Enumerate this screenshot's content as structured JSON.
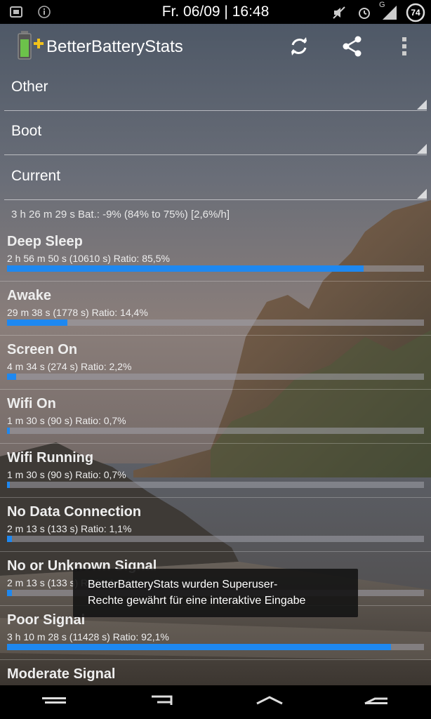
{
  "status_bar": {
    "time": "Fr. 06/09 | 16:48",
    "battery_level": "74",
    "left_icons": [
      "android-debug-icon",
      "info-icon"
    ],
    "right_icons": [
      "mute-icon",
      "alarm-icon",
      "signal-icon",
      "battery-icon"
    ],
    "signal_label": "G"
  },
  "app_bar": {
    "title": "BetterBatteryStats",
    "actions": [
      "refresh-icon",
      "share-icon",
      "overflow-menu-icon"
    ]
  },
  "spinners": [
    {
      "value": "Other"
    },
    {
      "value": "Boot"
    },
    {
      "value": "Current"
    }
  ],
  "summary": "3 h 26 m 29 s  Bat.: -9% (84% to 75%) [2,6%/h]",
  "stats": [
    {
      "name": "Deep Sleep",
      "detail": "2 h 56 m 50 s  (10610 s) Ratio: 85,5%",
      "ratio": 0.855
    },
    {
      "name": "Awake",
      "detail": "29 m 38 s  (1778 s) Ratio: 14,4%",
      "ratio": 0.144
    },
    {
      "name": "Screen On",
      "detail": "4 m 34 s  (274 s) Ratio: 2,2%",
      "ratio": 0.022
    },
    {
      "name": "Wifi On",
      "detail": "1 m 30 s  (90 s) Ratio: 0,7%",
      "ratio": 0.007
    },
    {
      "name": "Wifi Running",
      "detail": "1 m 30 s  (90 s) Ratio: 0,7%",
      "ratio": 0.007
    },
    {
      "name": "No Data Connection",
      "detail": "2 m 13 s  (133 s) Ratio: 1,1%",
      "ratio": 0.011
    },
    {
      "name": "No or Unknown Signal",
      "detail": "2 m 13 s  (133 s) Ratio: 1,1%",
      "ratio": 0.011
    },
    {
      "name": "Poor Signal",
      "detail": "3 h 10 m 28 s  (11428 s) Ratio: 92,1%",
      "ratio": 0.921
    },
    {
      "name": "Moderate Signal",
      "detail": "",
      "ratio": 0
    }
  ],
  "toast": {
    "line1": "BetterBatteryStats wurden Superuser-",
    "line2": "Rechte gewährt für eine interaktive Eingabe"
  },
  "nav_bar": {
    "buttons": [
      "menu-icon",
      "back-icon",
      "home-icon",
      "recent-apps-icon"
    ]
  },
  "colors": {
    "accent": "#1e88f0",
    "status_bar_bg": "#000000"
  }
}
